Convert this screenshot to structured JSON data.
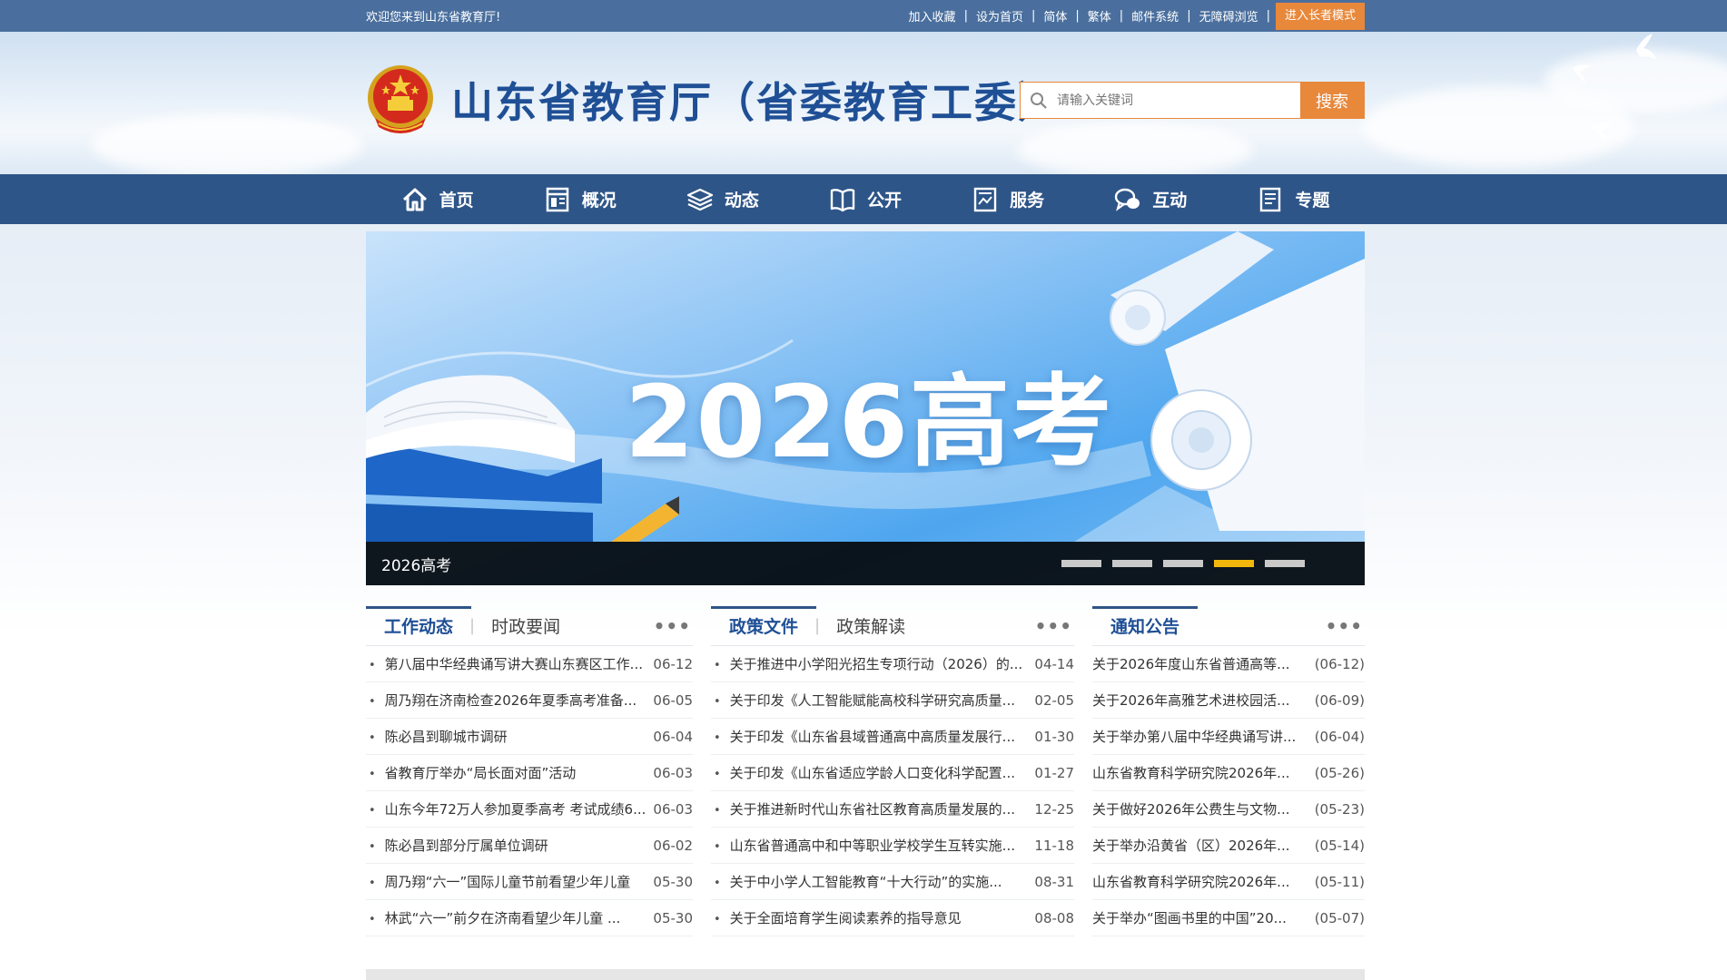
{
  "topbar": {
    "welcome": "欢迎您来到山东省教育厅!",
    "links": [
      "加入收藏",
      "设为首页",
      "简体",
      "繁体",
      "邮件系统",
      "无障碍浏览"
    ],
    "elder_mode": "进入长者模式"
  },
  "header": {
    "site_title": "山东省教育厅（省委教育工委）",
    "search_placeholder": "请输入关键词",
    "search_button": "搜索"
  },
  "nav": {
    "items": [
      {
        "label": "首页",
        "icon": "home-icon"
      },
      {
        "label": "概况",
        "icon": "overview-icon"
      },
      {
        "label": "动态",
        "icon": "news-stack-icon"
      },
      {
        "label": "公开",
        "icon": "book-icon"
      },
      {
        "label": "服务",
        "icon": "service-doc-icon"
      },
      {
        "label": "互动",
        "icon": "chat-icon"
      },
      {
        "label": "专题",
        "icon": "topic-doc-icon"
      }
    ]
  },
  "banner": {
    "title": "2026高考",
    "caption": "2026高考",
    "slide_count": 5,
    "active_slide": 4
  },
  "colors": {
    "primary": "#2e5588",
    "topbar": "#4a6f9e",
    "accent": "#e8883b",
    "title": "#1f4f95",
    "active_dot": "#f1b70c"
  },
  "columns": {
    "work": {
      "tab_active": "工作动态",
      "tab_other": "时政要闻",
      "more": "•••",
      "items": [
        {
          "title": "第八届中华经典诵写讲大赛山东赛区工作...",
          "date": "06-12"
        },
        {
          "title": "周乃翔在济南检查2026年夏季高考准备...",
          "date": "06-05"
        },
        {
          "title": "陈必昌到聊城市调研",
          "date": "06-04"
        },
        {
          "title": "省教育厅举办“局长面对面”活动",
          "date": "06-03"
        },
        {
          "title": "山东今年72万人参加夏季高考 考试成绩6...",
          "date": "06-03"
        },
        {
          "title": "陈必昌到部分厅属单位调研",
          "date": "06-02"
        },
        {
          "title": "周乃翔“六一”国际儿童节前看望少年儿童",
          "date": "05-30"
        },
        {
          "title": "林武“六一”前夕在济南看望少年儿童 ...",
          "date": "05-30"
        }
      ]
    },
    "policy": {
      "tab_active": "政策文件",
      "tab_other": "政策解读",
      "more": "•••",
      "items": [
        {
          "title": "关于推进中小学阳光招生专项行动（2026）的...",
          "date": "04-14"
        },
        {
          "title": "关于印发《人工智能赋能高校科学研究高质量...",
          "date": "02-05"
        },
        {
          "title": "关于印发《山东省县域普通高中高质量发展行...",
          "date": "01-30"
        },
        {
          "title": "关于印发《山东省适应学龄人口变化科学配置...",
          "date": "01-27"
        },
        {
          "title": "关于推进新时代山东省社区教育高质量发展的...",
          "date": "12-25"
        },
        {
          "title": "山东省普通高中和中等职业学校学生互转实施...",
          "date": "11-18"
        },
        {
          "title": "关于中小学人工智能教育“十大行动”的实施...",
          "date": "08-31"
        },
        {
          "title": "关于全面培育学生阅读素养的指导意见",
          "date": "08-08"
        }
      ]
    },
    "notice": {
      "tab_active": "通知公告",
      "more": "•••",
      "items": [
        {
          "title": "关于2026年度山东省普通高等...",
          "date": "(06-12)"
        },
        {
          "title": "关于2026年高雅艺术进校园活...",
          "date": "(06-09)"
        },
        {
          "title": "关于举办第八届中华经典诵写讲...",
          "date": "(06-04)"
        },
        {
          "title": "山东省教育科学研究院2026年...",
          "date": "(05-26)"
        },
        {
          "title": "关于做好2026年公费生与文物...",
          "date": "(05-23)"
        },
        {
          "title": "关于举办沿黄省（区）2026年...",
          "date": "(05-14)"
        },
        {
          "title": "山东省教育科学研究院2026年...",
          "date": "(05-11)"
        },
        {
          "title": "关于举办“图画书里的中国”20...",
          "date": "(05-07)"
        }
      ]
    }
  }
}
